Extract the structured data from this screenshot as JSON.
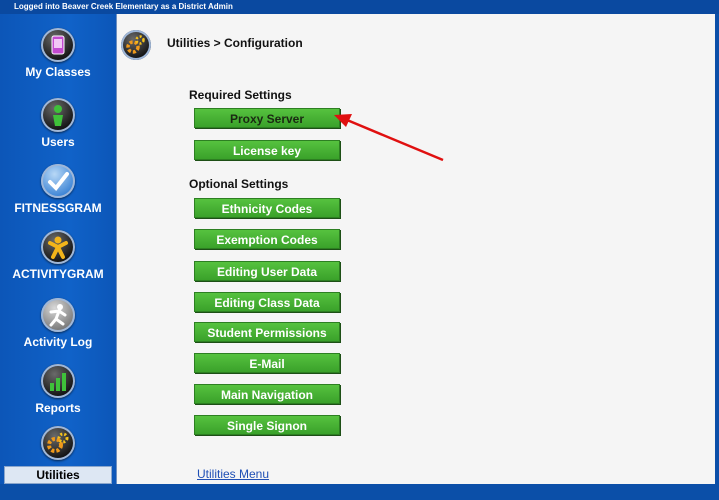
{
  "topbar": {
    "login_text": "Logged into Beaver Creek Elementary as a District Admin"
  },
  "sidebar": {
    "items": [
      {
        "label": "My Classes",
        "icon": "mobile-icon"
      },
      {
        "label": "Users",
        "icon": "user-icon"
      },
      {
        "label": "FITNESSGRAM",
        "icon": "checkmark-icon"
      },
      {
        "label": "ACTIVITYGRAM",
        "icon": "figure-icon"
      },
      {
        "label": "Activity Log",
        "icon": "runner-icon"
      },
      {
        "label": "Reports",
        "icon": "bar-chart-icon"
      },
      {
        "label": "Utilities",
        "icon": "gears-icon",
        "active": true
      }
    ]
  },
  "main": {
    "breadcrumb": "Utilities > Configuration",
    "required_title": "Required Settings",
    "required_buttons": [
      "Proxy Server",
      "License key"
    ],
    "optional_title": "Optional Settings",
    "optional_buttons": [
      "Ethnicity Codes",
      "Exemption Codes",
      "Editing User Data",
      "Editing Class Data",
      "Student Permissions",
      "E-Mail",
      "Main Navigation",
      "Single Signon"
    ],
    "footer_link": "Utilities Menu"
  },
  "colors": {
    "accent_green": "#3aa12a",
    "nav_blue": "#0b4fa8",
    "annotation_red": "#e01010"
  }
}
